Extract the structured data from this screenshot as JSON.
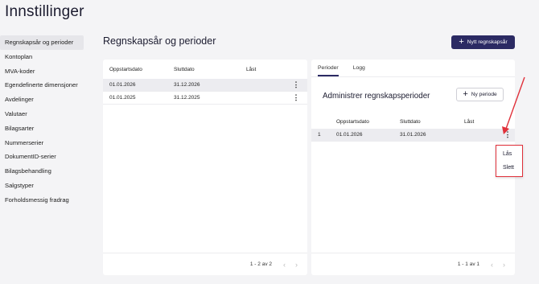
{
  "page": {
    "title": "Innstillinger"
  },
  "sidebar": {
    "items": [
      {
        "label": "Regnskapsår og perioder",
        "active": true
      },
      {
        "label": "Kontoplan"
      },
      {
        "label": "MVA-koder"
      },
      {
        "label": "Egendefinerte dimensjoner"
      },
      {
        "label": "Avdelinger"
      },
      {
        "label": "Valutaer"
      },
      {
        "label": "Bilagsarter"
      },
      {
        "label": "Nummerserier"
      },
      {
        "label": "DokumentID-serier"
      },
      {
        "label": "Bilagsbehandling"
      },
      {
        "label": "Salgstyper"
      },
      {
        "label": "Forholdsmessig fradrag"
      }
    ]
  },
  "main": {
    "title": "Regnskapsår og perioder",
    "new_button": "Nytt regnskapsår"
  },
  "years_table": {
    "headers": [
      "Oppstartsdato",
      "Sluttdato",
      "Låst"
    ],
    "rows": [
      {
        "start": "01.01.2026",
        "end": "31.12.2026",
        "locked": ""
      },
      {
        "start": "01.01.2025",
        "end": "31.12.2025",
        "locked": ""
      }
    ],
    "pager": "1 - 2 av 2"
  },
  "periods_panel": {
    "tabs": [
      "Perioder",
      "Logg"
    ],
    "title": "Administrer regnskapsperioder",
    "new_button": "Ny periode",
    "headers": [
      "",
      "Oppstartsdato",
      "Sluttdato",
      "Låst"
    ],
    "rows": [
      {
        "num": "1",
        "start": "01.01.2026",
        "end": "31.01.2026",
        "locked": ""
      }
    ],
    "pager": "1 - 1 av 1"
  },
  "context_menu": {
    "items": [
      "Lås",
      "Slett"
    ]
  },
  "icons": {
    "plus": "plus-icon",
    "kebab": "more-vertical-icon",
    "prev": "chevron-left-icon",
    "next": "chevron-right-icon"
  },
  "colors": {
    "primary": "#2b2a63",
    "annotation": "#e0303a",
    "background": "#f4f4f6"
  }
}
